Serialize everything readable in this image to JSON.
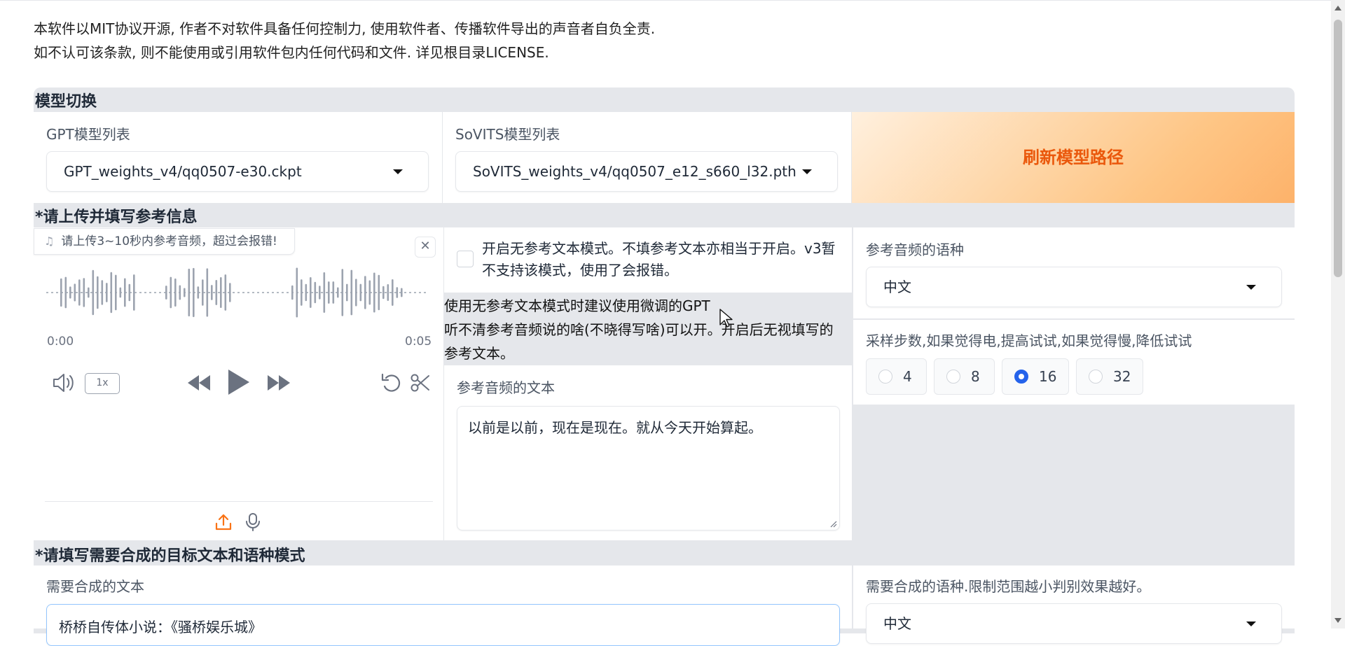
{
  "disclaimer": {
    "line1": "本软件以MIT协议开源, 作者不对软件具备任何控制力, 使用软件者、传播软件导出的声音者自负全责.",
    "line2": "如不认可该条款, 则不能使用或引用软件包内任何代码和文件. 详见根目录LICENSE."
  },
  "model_switch": {
    "title": "模型切换",
    "gpt_label": "GPT模型列表",
    "gpt_value": "GPT_weights_v4/qq0507-e30.ckpt",
    "sovits_label": "SoVITS模型列表",
    "sovits_value": "SoVITS_weights_v4/qq0507_e12_s660_l32.pth",
    "refresh_label": "刷新模型路径"
  },
  "reference": {
    "title": "*请上传并填写参考信息",
    "audio_label": "请上传3~10秒内参考音频，超过会报错!",
    "time_start": "0:00",
    "time_end": "0:05",
    "playback_rate": "1x",
    "no_ref_checkbox_label": "开启无参考文本模式。不填参考文本亦相当于开启。v3暂不支持该模式，使用了会报错。",
    "no_ref_checked": false,
    "info_line1": "使用无参考文本模式时建议使用微调的GPT",
    "info_line2": "听不清参考音频说的啥(不晓得写啥)可以开。开启后无视填写的",
    "info_line3": "参考文本。",
    "ref_text_label": "参考音频的文本",
    "ref_text_value": "以前是以前，现在是现在。就从今天开始算起。",
    "ref_lang_label": "参考音频的语种",
    "ref_lang_value": "中文",
    "steps_label": "采样步数,如果觉得电,提高试试,如果觉得慢,降低试试",
    "steps_options": [
      "4",
      "8",
      "16",
      "32"
    ],
    "steps_selected": "16"
  },
  "target": {
    "title": "*请填写需要合成的目标文本和语种模式",
    "text_label": "需要合成的文本",
    "text_value": "桥桥自传体小说：《骚桥娱乐城》",
    "lang_label": "需要合成的语种.限制范围越小判别效果越好。",
    "lang_value": "中文"
  },
  "colors": {
    "accent_orange": "#ea580c",
    "radio_blue": "#2563eb",
    "section_bg": "#e5e7eb"
  },
  "icons": {
    "note": "music-note-icon",
    "close": "close-icon",
    "volume": "volume-icon",
    "rewind": "rewind-icon",
    "play": "play-icon",
    "forward": "fast-forward-icon",
    "undo": "undo-icon",
    "trim": "scissors-icon",
    "upload": "upload-icon",
    "mic": "microphone-icon"
  }
}
